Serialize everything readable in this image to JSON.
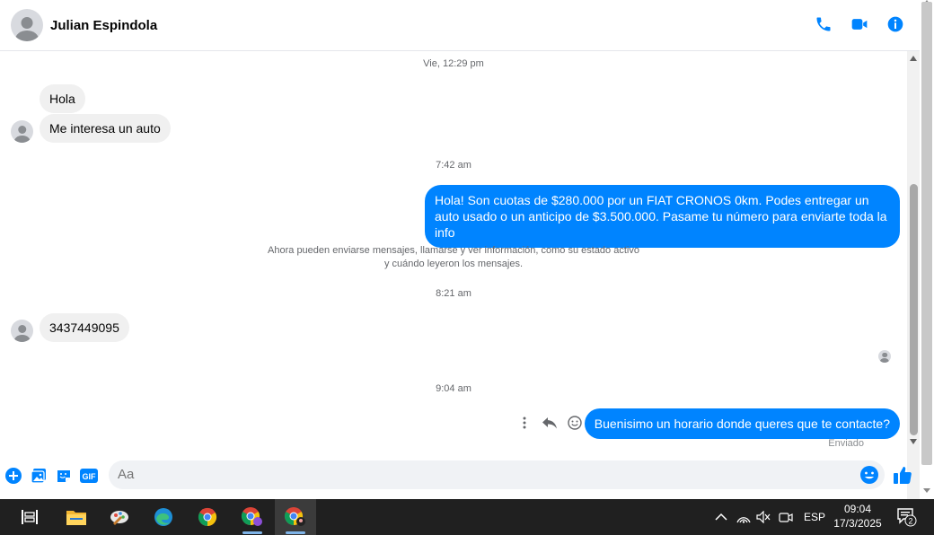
{
  "header": {
    "contact_name": "Julian Espindola"
  },
  "conversation": {
    "ts1": "Vie, 12:29 pm",
    "in1": "Hola",
    "in2": "Me interesa un auto",
    "ts2": "7:42 am",
    "out1": "Hola! Son cuotas de $280.000 por un FIAT CRONOS 0km. Podes entregar un auto usado o un anticipo de $3.500.000. Pasame tu número para enviarte toda la info",
    "system_note_line1": "Ahora pueden enviarse mensajes, llamarse y ver información, como su estado activo",
    "system_note_line2": "y cuándo leyeron los mensajes.",
    "ts3": "8:21 am",
    "in3": "3437449095",
    "ts4": "9:04 am",
    "out2": "Buenisimo un horario donde queres que te contacte?",
    "status": "Enviado"
  },
  "composer": {
    "placeholder": "Aa",
    "gif_label": "GIF"
  },
  "taskbar": {
    "language": "ESP",
    "time": "09:04",
    "date": "17/3/2025",
    "notification_count": "2"
  },
  "colors": {
    "accent": "#0084ff",
    "incoming_bubble": "#f0f0f0",
    "taskbar": "#202020"
  }
}
